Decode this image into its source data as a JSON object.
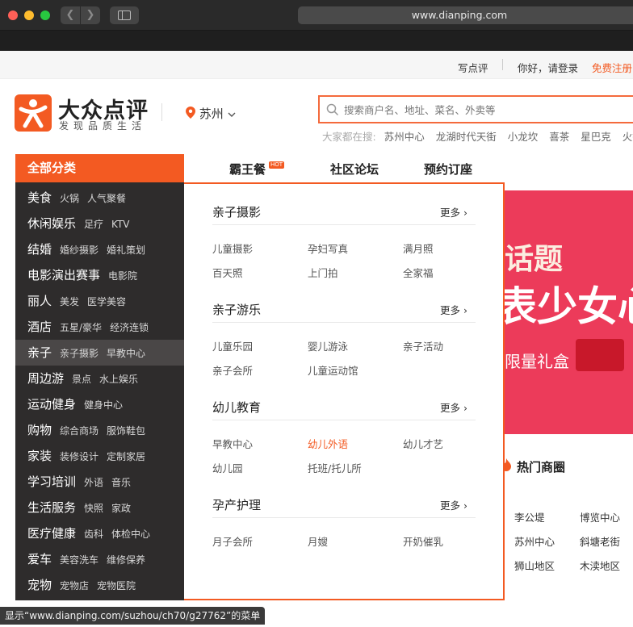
{
  "browser": {
    "url": "www.dianping.com",
    "status_text": "显示“www.dianping.com/suzhou/ch70/g27762”的菜单"
  },
  "topbar": {
    "write_review": "写点评",
    "greeting": "你好，请登录",
    "register": "免费注册"
  },
  "brand": {
    "name": "大众点评",
    "slogan": "发现品质生活",
    "color": "#f35a22"
  },
  "location": {
    "city": "苏州"
  },
  "search": {
    "placeholder": "搜索商户名、地址、菜名、外卖等",
    "hot_label": "大家都在搜:",
    "hot_terms": [
      "苏州中心",
      "龙湖时代天街",
      "小龙坎",
      "喜茶",
      "星巴克",
      "火锅"
    ]
  },
  "nav": {
    "all_categories": "全部分类",
    "links": [
      "霸王餐",
      "社区论坛",
      "预约订座"
    ],
    "hot_badge": "HOT"
  },
  "categories": [
    {
      "main": "美食",
      "subs": [
        "火锅",
        "人气聚餐"
      ]
    },
    {
      "main": "休闲娱乐",
      "subs": [
        "足疗",
        "KTV"
      ]
    },
    {
      "main": "结婚",
      "subs": [
        "婚纱摄影",
        "婚礼策划"
      ]
    },
    {
      "main": "电影演出赛事",
      "subs": [
        "电影院"
      ]
    },
    {
      "main": "丽人",
      "subs": [
        "美发",
        "医学美容"
      ]
    },
    {
      "main": "酒店",
      "subs": [
        "五星/豪华",
        "经济连锁"
      ]
    },
    {
      "main": "亲子",
      "subs": [
        "亲子摄影",
        "早教中心"
      ],
      "active": true
    },
    {
      "main": "周边游",
      "subs": [
        "景点",
        "水上娱乐"
      ]
    },
    {
      "main": "运动健身",
      "subs": [
        "健身中心"
      ]
    },
    {
      "main": "购物",
      "subs": [
        "综合商场",
        "服饰鞋包"
      ]
    },
    {
      "main": "家装",
      "subs": [
        "装修设计",
        "定制家居"
      ]
    },
    {
      "main": "学习培训",
      "subs": [
        "外语",
        "音乐"
      ]
    },
    {
      "main": "生活服务",
      "subs": [
        "快照",
        "家政"
      ]
    },
    {
      "main": "医疗健康",
      "subs": [
        "齿科",
        "体检中心"
      ]
    },
    {
      "main": "爱车",
      "subs": [
        "美容洗车",
        "维修保养"
      ]
    },
    {
      "main": "宠物",
      "subs": [
        "宠物店",
        "宠物医院"
      ]
    }
  ],
  "popup": {
    "more_label": "更多",
    "sections": [
      {
        "title": "亲子摄影",
        "items": [
          "儿童摄影",
          "孕妇写真",
          "满月照",
          "百天照",
          "上门拍",
          "全家福"
        ]
      },
      {
        "title": "亲子游乐",
        "items": [
          "儿童乐园",
          "婴儿游泳",
          "亲子活动",
          "亲子会所",
          "儿童运动馆"
        ]
      },
      {
        "title": "幼儿教育",
        "items": [
          "早教中心",
          "幼儿外语",
          "幼儿才艺",
          "幼儿园",
          "托班/托儿所"
        ],
        "highlight_index": 1
      },
      {
        "title": "孕产护理",
        "items": [
          "月子会所",
          "月嫂",
          "开奶催乳"
        ]
      }
    ]
  },
  "banner": {
    "line1": "话题",
    "line2": "表少女心",
    "line3": "限量礼盒",
    "color": "#ec3b5a"
  },
  "hot_malls": {
    "title": "热门商圈",
    "items": [
      "李公堤",
      "博览中心",
      "苏州中心",
      "斜塘老街",
      "狮山地区",
      "木渎地区"
    ]
  }
}
